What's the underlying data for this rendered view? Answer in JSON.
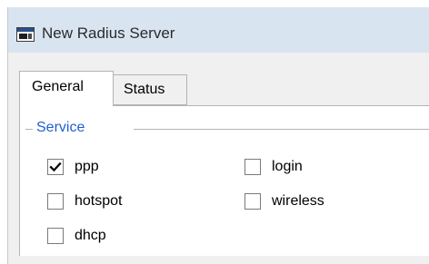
{
  "window": {
    "title": "New Radius Server",
    "icon": "window-app-icon"
  },
  "tabs": [
    {
      "label": "General",
      "active": true
    },
    {
      "label": "Status",
      "active": false
    }
  ],
  "service_group": {
    "label": "Service",
    "options": [
      {
        "label": "ppp",
        "checked": true
      },
      {
        "label": "login",
        "checked": false
      },
      {
        "label": "hotspot",
        "checked": false
      },
      {
        "label": "wireless",
        "checked": false
      },
      {
        "label": "dhcp",
        "checked": false
      }
    ]
  },
  "colors": {
    "titlebar": "#d9e4f1",
    "group_label": "#1f5fd2",
    "window_bg": "#f0f0f0"
  }
}
